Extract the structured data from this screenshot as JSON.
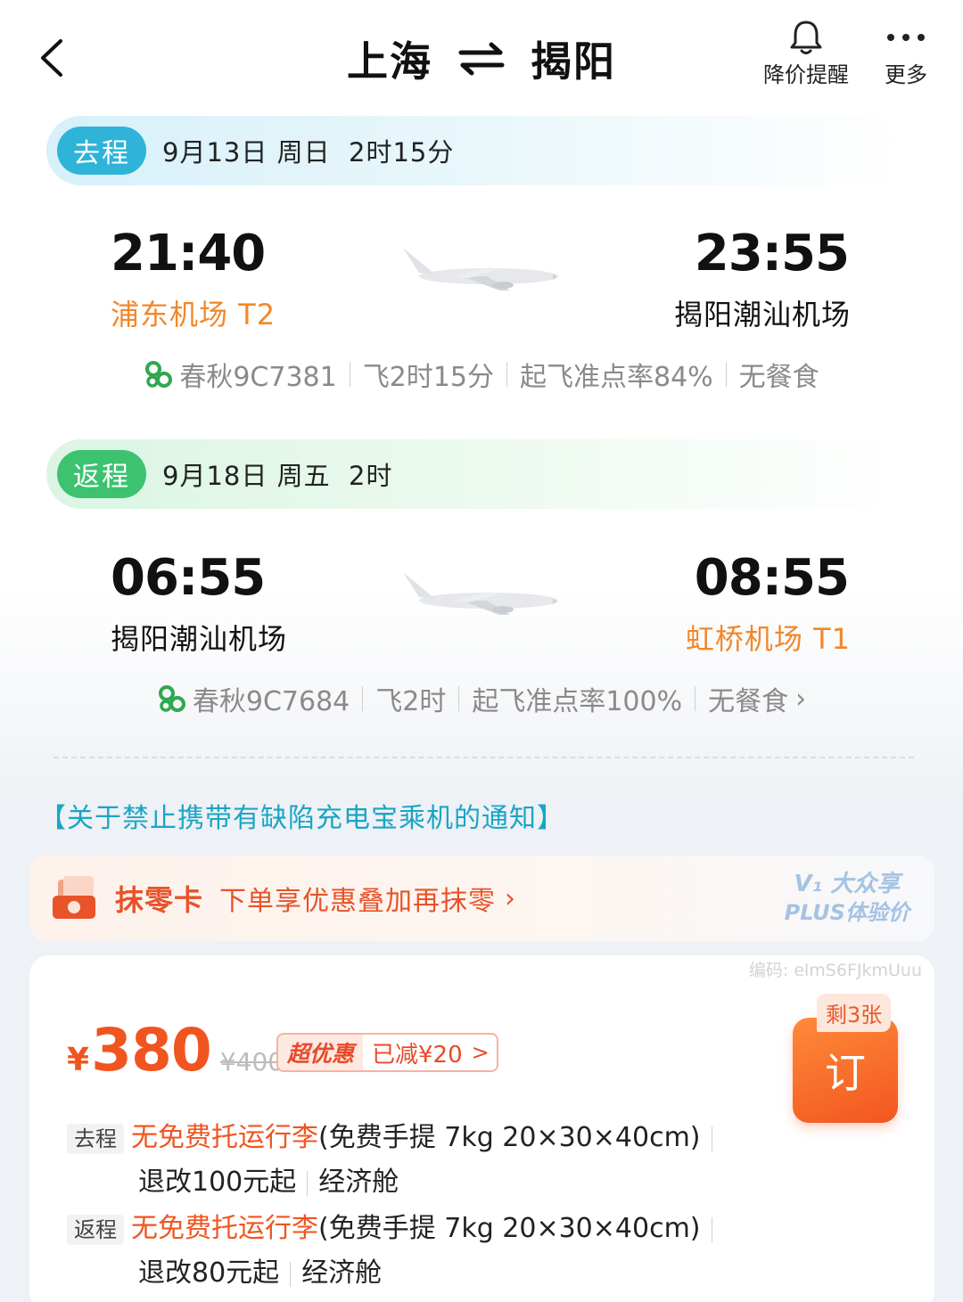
{
  "header": {
    "origin": "上海",
    "destination": "揭阳",
    "price_alert_label": "降价提醒",
    "more_label": "更多"
  },
  "outbound": {
    "tag": "去程",
    "date_info": "9月13日 周日  2时15分",
    "dep_time": "21:40",
    "dep_airport": "浦东机场 T2",
    "arr_time": "23:55",
    "arr_airport": "揭阳潮汕机场",
    "airline_flight": "春秋9C7381",
    "duration": "飞2时15分",
    "punctuality": "起飞准点率84%",
    "meal": "无餐食"
  },
  "inbound": {
    "tag": "返程",
    "date_info": "9月18日 周五  2时",
    "dep_time": "06:55",
    "dep_airport": "揭阳潮汕机场",
    "arr_time": "08:55",
    "arr_airport": "虹桥机场 T1",
    "airline_flight": "春秋9C7684",
    "duration": "飞2时",
    "punctuality": "起飞准点率100%",
    "meal": "无餐食",
    "meal_arrow": "›"
  },
  "notice": "【关于禁止携带有缺陷充电宝乘机的通知】",
  "promo": {
    "title": "抹零卡",
    "desc": "下单享优惠叠加再抹零",
    "arrow": "›",
    "plus_line1": "V₁ 大众享",
    "plus_line2": "PLUS体验价"
  },
  "ticket": {
    "code": "编码: elmS6FJkmUuu",
    "currency": "¥",
    "price": "380",
    "original_price": "¥400",
    "deal_label": "超优惠",
    "discount": "已减¥20",
    "discount_arrow": ">",
    "remaining": "剩3张",
    "book_label": "订",
    "out_tag": "去程",
    "out_baggage": "无免费托运行李",
    "out_carry": "(免费手提 7kg 20×30×40cm)",
    "out_refund": "退改100元起",
    "out_cabin": "经济舱",
    "in_tag": "返程",
    "in_baggage": "无免费托运行李",
    "in_carry": "(免费手提 7kg 20×30×40cm)",
    "in_refund": "退改80元起",
    "in_cabin": "经济舱"
  },
  "colors": {
    "accent_orange": "#f0551f",
    "outbound_blue": "#2fb3d8",
    "inbound_green": "#3dc270",
    "notice_blue": "#1aa5c7"
  },
  "icons": {
    "back": "chevron-left-icon",
    "swap": "swap-arrows-icon",
    "bell": "bell-icon",
    "more": "more-dots-icon",
    "plane": "airplane-icon",
    "airline": "spring-airlines-logo-icon",
    "promo": "coupon-card-icon"
  }
}
